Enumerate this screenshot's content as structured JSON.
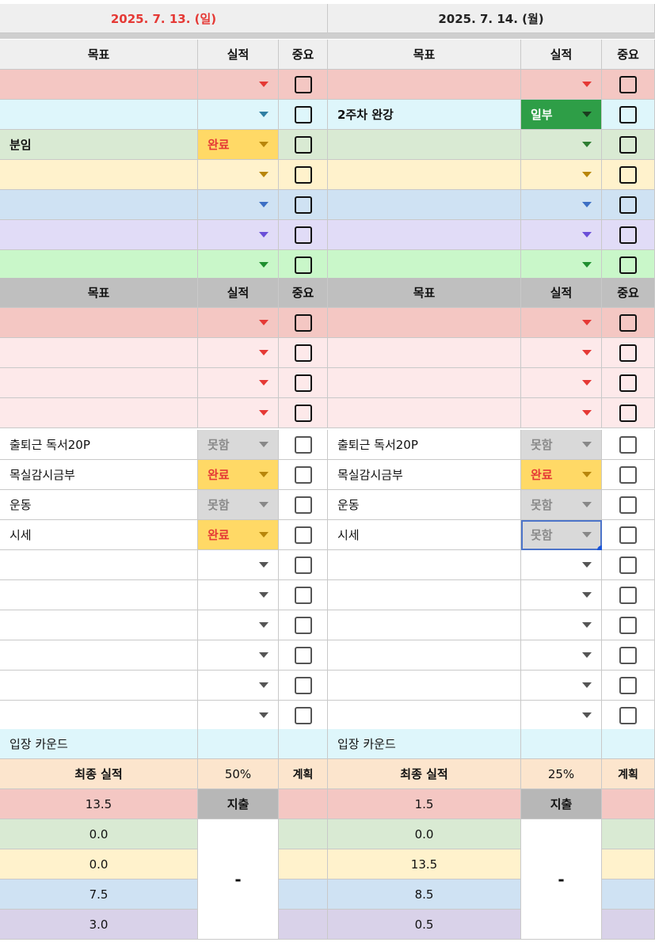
{
  "days": [
    {
      "date_label": "2025. 7. 13. (일)",
      "date_color": "#e53935",
      "header1": {
        "goal": "목표",
        "result": "실적",
        "important": "중요"
      },
      "color_rows": [
        {
          "text": "",
          "status": "",
          "bg": "#f4c7c3"
        },
        {
          "text": "",
          "status": "",
          "bg": "#def6fb"
        },
        {
          "text": "분임",
          "status": "완료",
          "bg": "#d9ead3"
        },
        {
          "text": "",
          "status": "",
          "bg": "#fff2cc"
        },
        {
          "text": "",
          "status": "",
          "bg": "#cfe2f3"
        },
        {
          "text": "",
          "status": "",
          "bg": "#e1dcf7"
        },
        {
          "text": "",
          "status": "",
          "bg": "#c9f7c9"
        }
      ],
      "header2": {
        "goal": "목표",
        "result": "실적",
        "important": "중요"
      },
      "pink_rows": [
        "",
        "",
        "",
        ""
      ],
      "task_rows": [
        {
          "text": "출퇴근 독서20P",
          "status": "못함"
        },
        {
          "text": "목실감시금부",
          "status": "완료"
        },
        {
          "text": "운동",
          "status": "못함"
        },
        {
          "text": "시세",
          "status": "완료"
        },
        {
          "text": "",
          "status": ""
        },
        {
          "text": "",
          "status": ""
        },
        {
          "text": "",
          "status": ""
        },
        {
          "text": "",
          "status": ""
        },
        {
          "text": "",
          "status": ""
        },
        {
          "text": "",
          "status": ""
        }
      ],
      "count_label": "입장 카운드",
      "final_label": "최종 실적",
      "final_pct": "50%",
      "plan_label": "계획",
      "expense_label": "지출",
      "expense_value": "-",
      "totals": [
        "13.5",
        "0.0",
        "0.0",
        "7.5",
        "3.0"
      ]
    },
    {
      "date_label": "2025. 7. 14. (월)",
      "date_color": "#222222",
      "header1": {
        "goal": "목표",
        "result": "실적",
        "important": "중요"
      },
      "color_rows": [
        {
          "text": "",
          "status": "",
          "bg": "#f4c7c3"
        },
        {
          "text": "2주차 완강",
          "status": "일부",
          "bg": "#def6fb"
        },
        {
          "text": "",
          "status": "",
          "bg": "#d9ead3"
        },
        {
          "text": "",
          "status": "",
          "bg": "#fff2cc"
        },
        {
          "text": "",
          "status": "",
          "bg": "#cfe2f3"
        },
        {
          "text": "",
          "status": "",
          "bg": "#e1dcf7"
        },
        {
          "text": "",
          "status": "",
          "bg": "#c9f7c9"
        }
      ],
      "header2": {
        "goal": "목표",
        "result": "실적",
        "important": "중요"
      },
      "pink_rows": [
        "",
        "",
        "",
        ""
      ],
      "task_rows": [
        {
          "text": "출퇴근 독서20P",
          "status": "못함"
        },
        {
          "text": "목실감시금부",
          "status": "완료"
        },
        {
          "text": "운동",
          "status": "못함"
        },
        {
          "text": "시세",
          "status": "못함"
        },
        {
          "text": "",
          "status": ""
        },
        {
          "text": "",
          "status": ""
        },
        {
          "text": "",
          "status": ""
        },
        {
          "text": "",
          "status": ""
        },
        {
          "text": "",
          "status": ""
        },
        {
          "text": "",
          "status": ""
        }
      ],
      "count_label": "입장 카운드",
      "final_label": "최종 실적",
      "final_pct": "25%",
      "plan_label": "계획",
      "expense_label": "지출",
      "expense_value": "-",
      "totals": [
        "1.5",
        "0.0",
        "13.5",
        "8.5",
        "0.5"
      ]
    }
  ],
  "colors": {
    "header_bg": "#efefef",
    "header2_bg": "#bfbfbf",
    "pink_light": "#fde9ea",
    "count_bg": "#def6fb",
    "final_bg": "#fce5cd",
    "expense_bg": "#b7b7b7",
    "total_bgs": [
      "#f4c7c3",
      "#d9ead3",
      "#fff2cc",
      "#cfe2f3",
      "#d9d2e9"
    ],
    "status": {
      "완료": {
        "bg": "#ffd966",
        "fg": "#e53935"
      },
      "일부": {
        "bg": "#2e9e47",
        "fg": "#ffffff"
      },
      "못함": {
        "bg": "#d9d9d9",
        "fg": "#8a8a8a"
      }
    },
    "caret_colors": [
      "#e53935",
      "#2f7fa3",
      "#2e7d32",
      "#b8860b",
      "#3d6fc4",
      "#6a4fd8",
      "#1f8f2f"
    ]
  },
  "selected_cell": {
    "day": 1,
    "row": "task",
    "index": 3
  }
}
